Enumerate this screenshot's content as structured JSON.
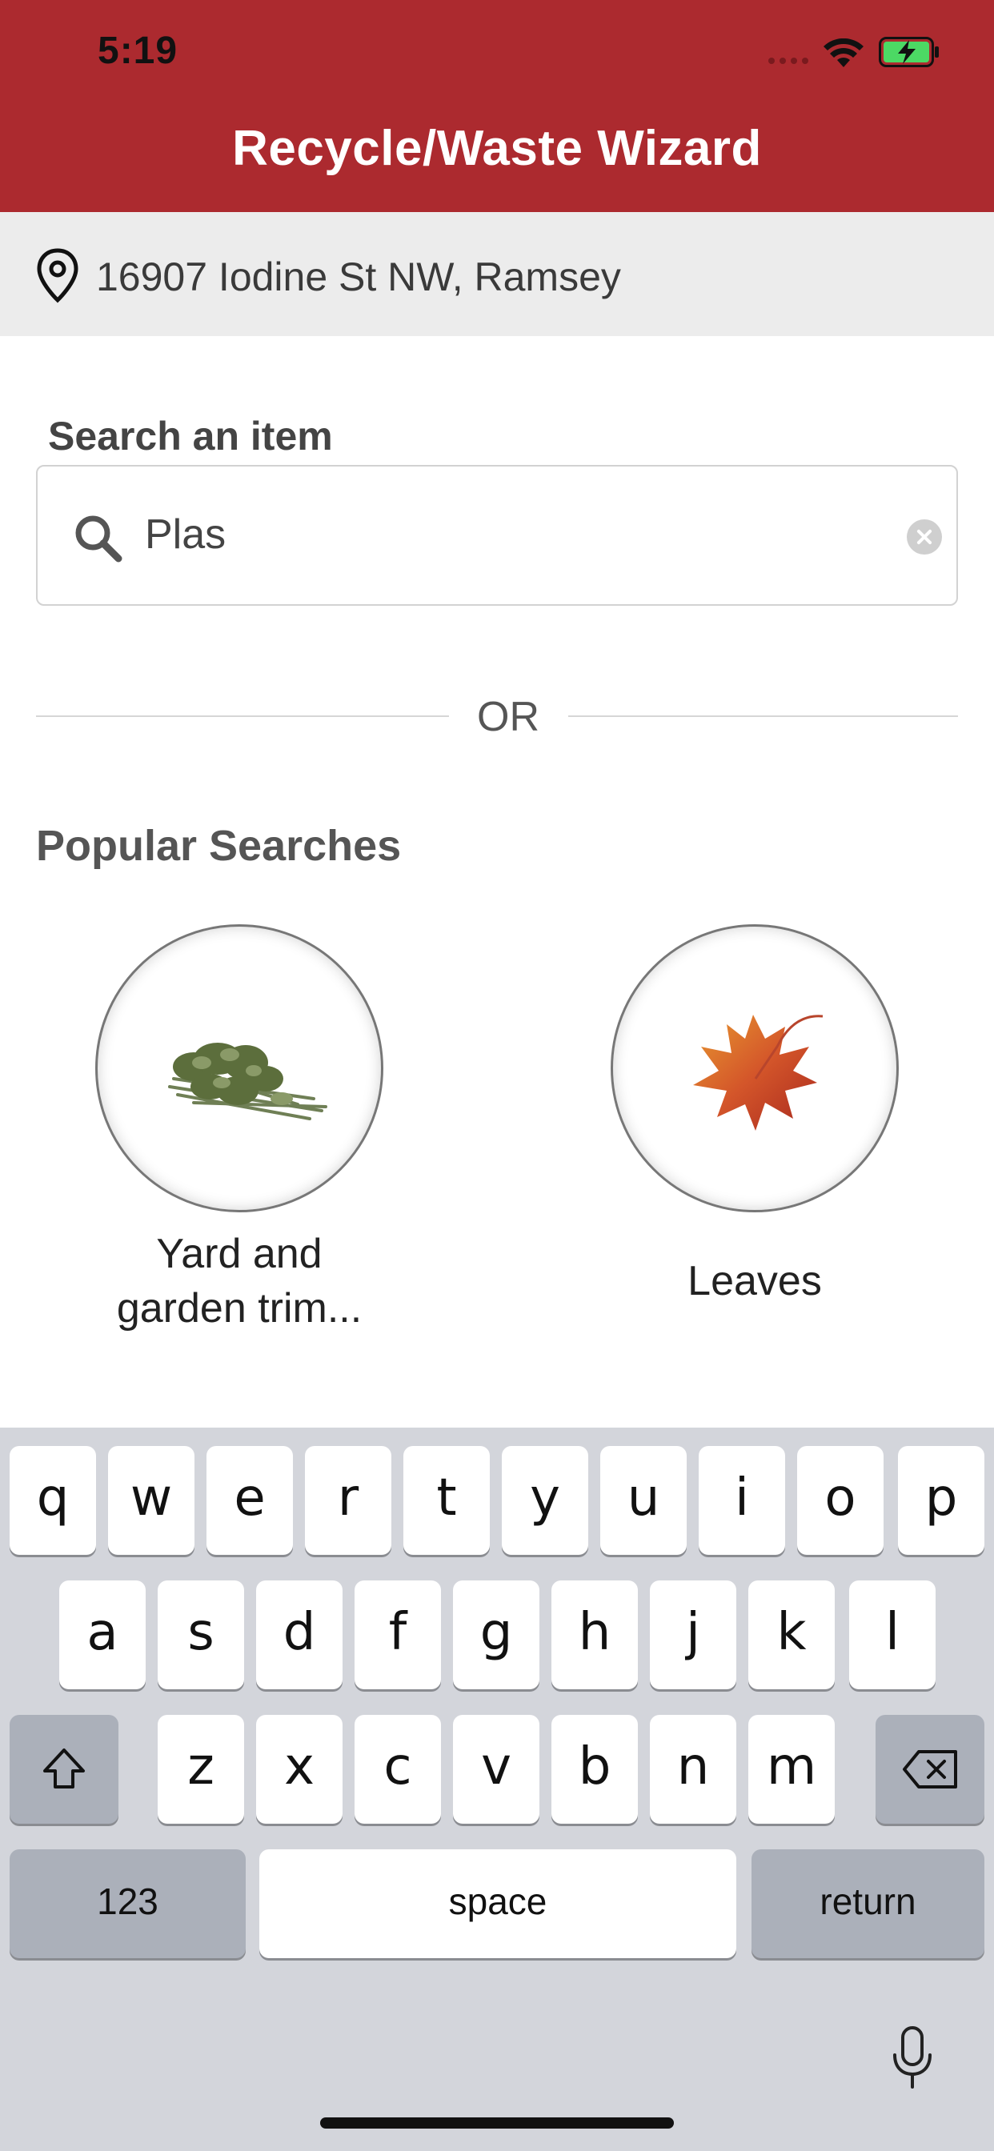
{
  "status_bar": {
    "time": "5:19"
  },
  "header": {
    "title": "Recycle/Waste Wizard"
  },
  "address": {
    "text": "16907 Iodine St NW, Ramsey"
  },
  "search": {
    "label": "Search an item",
    "value": "Plas"
  },
  "divider": {
    "text": "OR"
  },
  "popular": {
    "title": "Popular Searches",
    "items": [
      {
        "label_line1": "Yard and",
        "label_line2": "garden trim...",
        "icon": "yard-trimmings-image"
      },
      {
        "label_line1": "Leaves",
        "label_line2": "",
        "icon": "maple-leaf-image"
      }
    ]
  },
  "keyboard": {
    "row1": [
      "q",
      "w",
      "e",
      "r",
      "t",
      "y",
      "u",
      "i",
      "o",
      "p"
    ],
    "row2": [
      "a",
      "s",
      "d",
      "f",
      "g",
      "h",
      "j",
      "k",
      "l"
    ],
    "row3": [
      "z",
      "x",
      "c",
      "v",
      "b",
      "n",
      "m"
    ],
    "numbers_label": "123",
    "space_label": "space",
    "return_label": "return"
  },
  "colors": {
    "header": "#ac2a2f",
    "address_bar": "#ececec",
    "keyboard_bg": "#d3d5db"
  }
}
